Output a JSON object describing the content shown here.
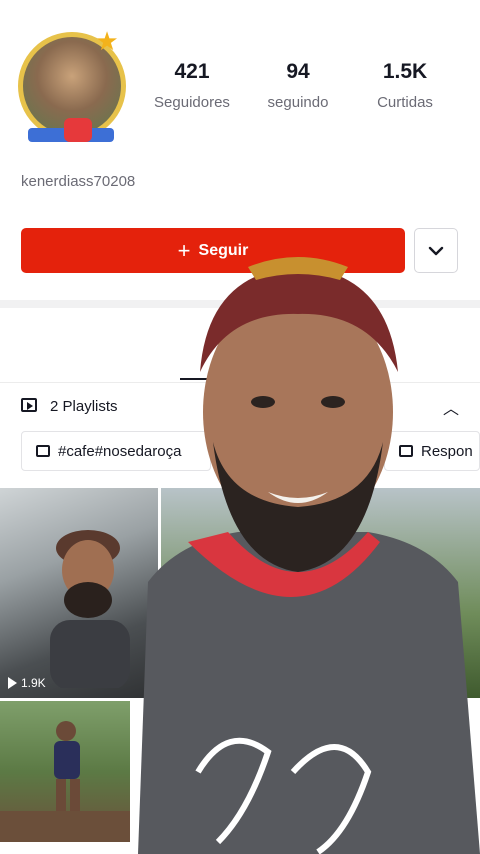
{
  "profile": {
    "username": "kenerdiass70208",
    "stats": [
      {
        "value": "421",
        "label": "Seguidores"
      },
      {
        "value": "94",
        "label": "seguindo"
      },
      {
        "value": "1.5K",
        "label": "Curtidas"
      }
    ],
    "follow_label": "Seguir"
  },
  "playlists": {
    "header_label": "2 Playlists",
    "items": [
      {
        "label": "#cafe#nosedaroça"
      },
      {
        "label": "Respon"
      }
    ]
  },
  "videos": [
    {
      "views": "1.9K"
    }
  ],
  "colors": {
    "accent": "#e4220c",
    "text": "#161823",
    "secondary": "#6b6b75"
  }
}
